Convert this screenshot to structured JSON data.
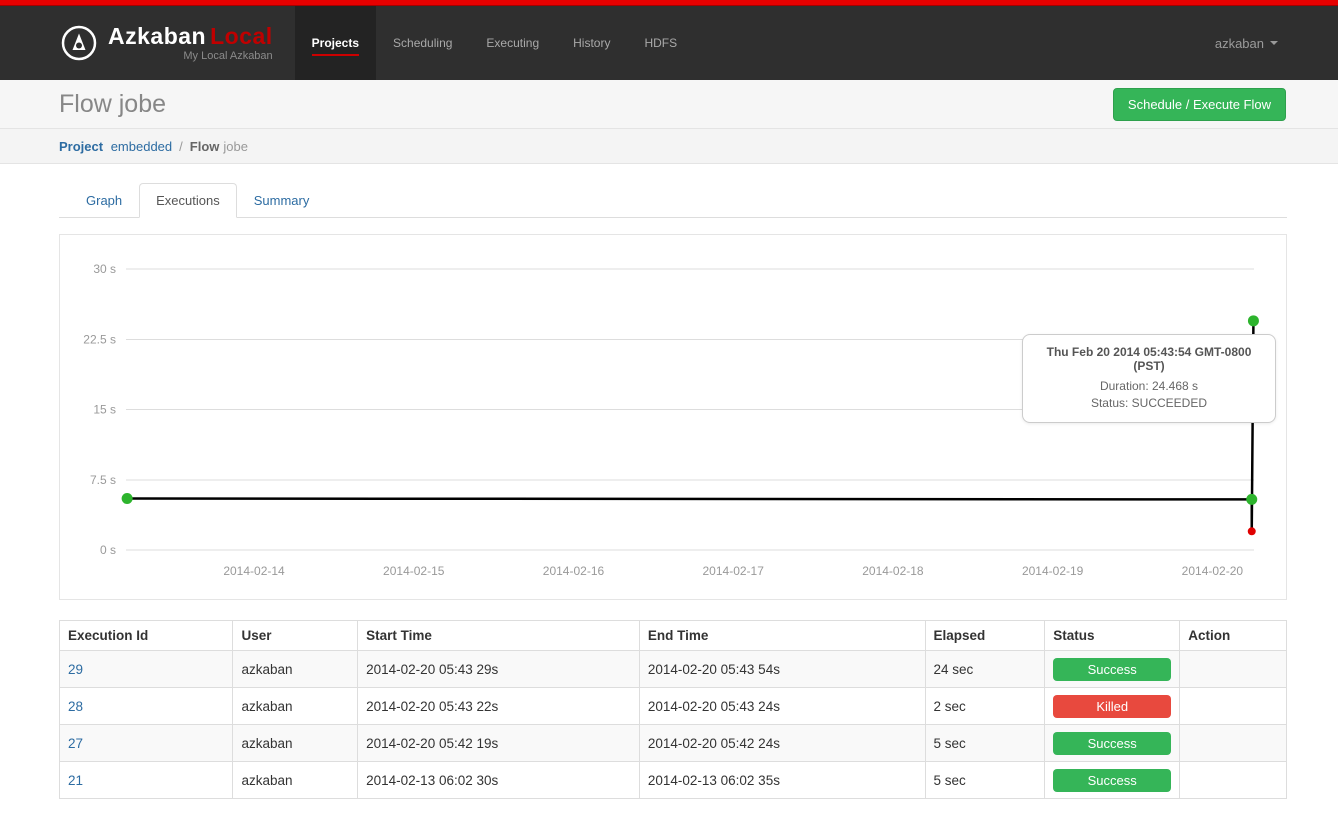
{
  "navbar": {
    "brand": "Azkaban",
    "brand_accent": "Local",
    "subtitle": "My Local Azkaban",
    "items": [
      {
        "label": "Projects",
        "active": true
      },
      {
        "label": "Scheduling",
        "active": false
      },
      {
        "label": "Executing",
        "active": false
      },
      {
        "label": "History",
        "active": false
      },
      {
        "label": "HDFS",
        "active": false
      }
    ],
    "user": "azkaban"
  },
  "header": {
    "title_prefix": "Flow",
    "title_name": "jobe",
    "action_button": "Schedule / Execute Flow"
  },
  "breadcrumb": {
    "project_label": "Project",
    "project_name": "embedded",
    "separator": "/",
    "flow_label": "Flow",
    "flow_name": "jobe"
  },
  "tabs": [
    {
      "label": "Graph",
      "active": false
    },
    {
      "label": "Executions",
      "active": true
    },
    {
      "label": "Summary",
      "active": false
    }
  ],
  "chart_data": {
    "type": "line",
    "title": "",
    "xlabel": "",
    "ylabel": "",
    "ylim": [
      0,
      30
    ],
    "grid": true,
    "line_color": "#000000",
    "point_colors": {
      "SUCCEEDED": "#2db42d",
      "KILLED": "#e00000"
    },
    "y_ticks": [
      {
        "label": "30 s",
        "value": 30
      },
      {
        "label": "22.5 s",
        "value": 22.5
      },
      {
        "label": "15 s",
        "value": 15
      },
      {
        "label": "7.5 s",
        "value": 7.5
      },
      {
        "label": "0 s",
        "value": 0
      }
    ],
    "x_ticks": [
      {
        "label": "2014-02-14",
        "frac": 0.1135
      },
      {
        "label": "2014-02-15",
        "frac": 0.2551
      },
      {
        "label": "2014-02-16",
        "frac": 0.3967
      },
      {
        "label": "2014-02-17",
        "frac": 0.5383
      },
      {
        "label": "2014-02-18",
        "frac": 0.6799
      },
      {
        "label": "2014-02-19",
        "frac": 0.8215
      },
      {
        "label": "2014-02-20",
        "frac": 0.9631
      }
    ],
    "points": [
      {
        "time": "2014-02-13 06:02",
        "duration_s": 5.5,
        "status": "SUCCEEDED",
        "frac": 0.001
      },
      {
        "time": "2014-02-20 05:42",
        "duration_s": 5.4,
        "status": "SUCCEEDED",
        "frac": 0.998
      },
      {
        "time": "2014-02-20 05:43",
        "duration_s": 2.0,
        "status": "KILLED",
        "frac": 0.998
      },
      {
        "time": "2014-02-20 05:43",
        "duration_s": 24.468,
        "status": "SUCCEEDED",
        "frac": 0.9995
      }
    ],
    "tooltip": {
      "title": "Thu Feb 20 2014 05:43:54 GMT-0800 (PST)",
      "duration_line": "Duration: 24.468 s",
      "status_line": "Status: SUCCEEDED"
    }
  },
  "table": {
    "columns": [
      "Execution Id",
      "User",
      "Start Time",
      "End Time",
      "Elapsed",
      "Status",
      "Action"
    ],
    "rows": [
      {
        "execution_id": "29",
        "user": "azkaban",
        "start_time": "2014-02-20 05:43 29s",
        "end_time": "2014-02-20 05:43 54s",
        "elapsed": "24 sec",
        "status": "Success",
        "status_type": "success",
        "action": ""
      },
      {
        "execution_id": "28",
        "user": "azkaban",
        "start_time": "2014-02-20 05:43 22s",
        "end_time": "2014-02-20 05:43 24s",
        "elapsed": "2 sec",
        "status": "Killed",
        "status_type": "killed",
        "action": ""
      },
      {
        "execution_id": "27",
        "user": "azkaban",
        "start_time": "2014-02-20 05:42 19s",
        "end_time": "2014-02-20 05:42 24s",
        "elapsed": "5 sec",
        "status": "Success",
        "status_type": "success",
        "action": ""
      },
      {
        "execution_id": "21",
        "user": "azkaban",
        "start_time": "2014-02-13 06:02 30s",
        "end_time": "2014-02-13 06:02 35s",
        "elapsed": "5 sec",
        "status": "Success",
        "status_type": "success",
        "action": ""
      }
    ]
  },
  "colors": {
    "accent_red": "#cc0000",
    "button_green": "#35b558",
    "killed_red": "#e8493e",
    "link_blue": "#2d6ca2"
  }
}
